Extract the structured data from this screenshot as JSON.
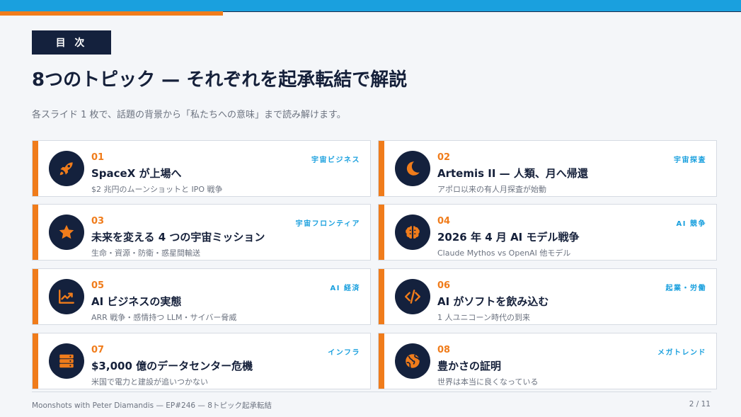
{
  "colors": {
    "navy": "#14213d",
    "orange": "#f07c1b",
    "blue": "#1aa0de",
    "background": "#f4f6f9"
  },
  "header": {
    "badge": "目 次",
    "title": "8つのトピック — それぞれを起承転結で解説",
    "subtitle": "各スライド 1 枚で、話題の背景から「私たちへの意味」まで読み解けます。"
  },
  "topics": [
    {
      "num": "01",
      "category": "宇宙ビジネス",
      "title": "SpaceX が上場へ",
      "desc": "$2 兆円のムーンショットと IPO 戦争",
      "icon": "rocket-icon"
    },
    {
      "num": "02",
      "category": "宇宙探査",
      "title": "Artemis II — 人類、月へ帰還",
      "desc": "アポロ以来の有人月探査が始動",
      "icon": "moon-icon"
    },
    {
      "num": "03",
      "category": "宇宙フロンティア",
      "title": "未来を変える 4 つの宇宙ミッション",
      "desc": "生命・資源・防衛・惑星間輸送",
      "icon": "star-icon"
    },
    {
      "num": "04",
      "category": "AI 競争",
      "title": "2026 年 4 月 AI モデル戦争",
      "desc": "Claude Mythos vs OpenAI 他モデル",
      "icon": "brain-icon"
    },
    {
      "num": "05",
      "category": "AI 経済",
      "title": "AI ビジネスの実態",
      "desc": "ARR 戦争・感情持つ LLM・サイバー脅威",
      "icon": "chart-up-icon"
    },
    {
      "num": "06",
      "category": "起業・労働",
      "title": "AI がソフトを飲み込む",
      "desc": "1 人ユニコーン時代の到来",
      "icon": "code-icon"
    },
    {
      "num": "07",
      "category": "インフラ",
      "title": "$3,000 億のデータセンター危機",
      "desc": "米国で電力と建設が追いつかない",
      "icon": "server-icon"
    },
    {
      "num": "08",
      "category": "メガトレンド",
      "title": "豊かさの証明",
      "desc": "世界は本当に良くなっている",
      "icon": "globe-icon"
    }
  ],
  "footer": {
    "left": "Moonshots with Peter Diamandis — EP#246 — 8トピック起承転結",
    "page": "2 / 11"
  }
}
